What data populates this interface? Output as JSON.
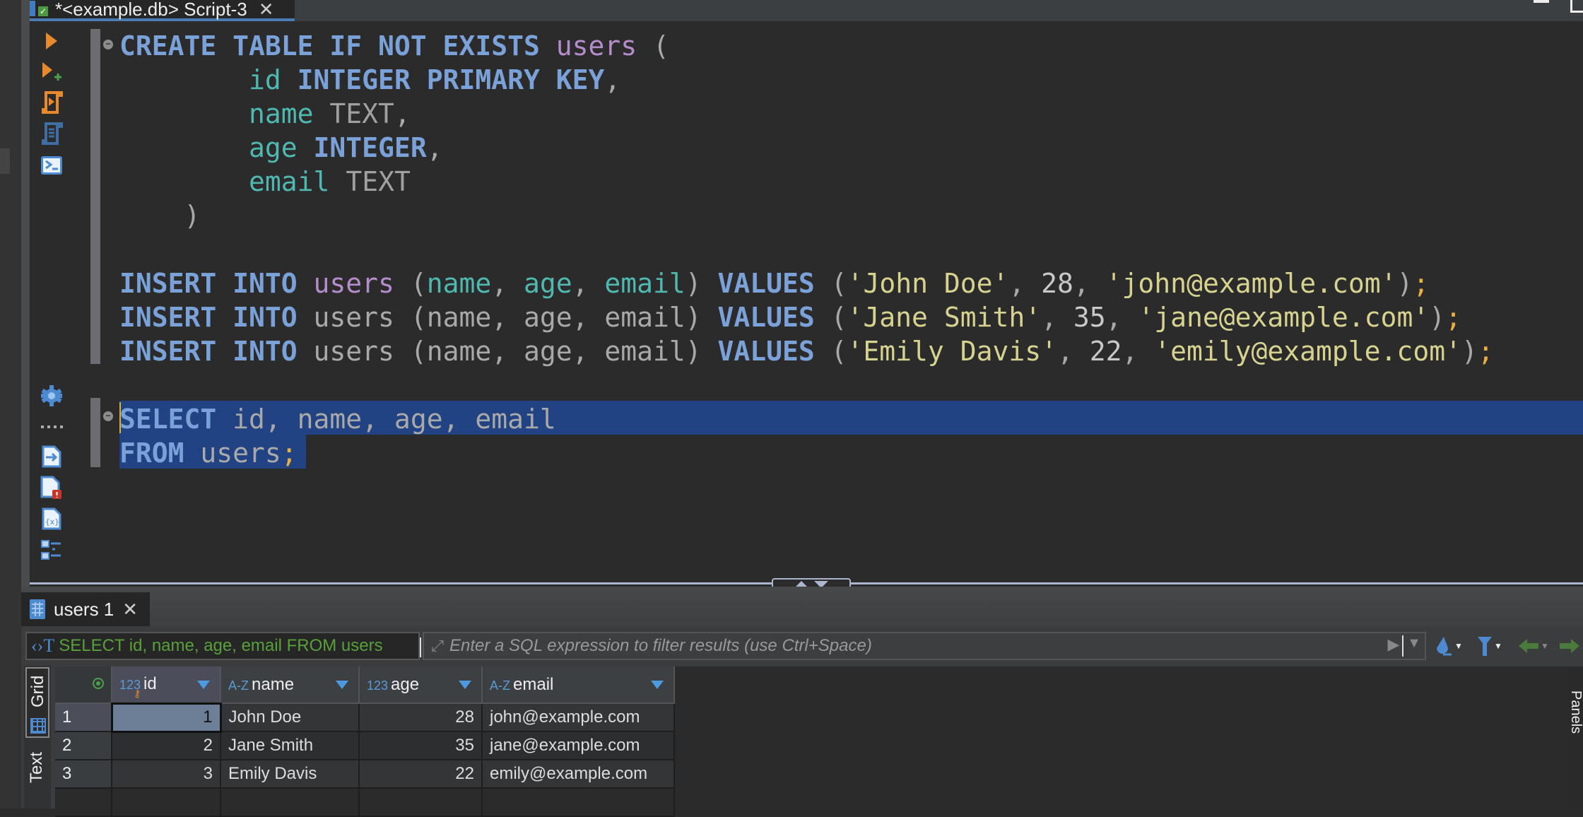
{
  "window": {
    "editor_tab": {
      "title": "*<example.db> Script-3",
      "icon": "sqlite-db-connected-icon",
      "close": "✕"
    }
  },
  "editor_toolbar": [
    {
      "name": "execute-statement",
      "icon": "play-icon"
    },
    {
      "name": "execute-in-new-tab",
      "icon": "play-plus-icon"
    },
    {
      "name": "execute-script",
      "icon": "script-run-icon"
    },
    {
      "name": "execute-script-new-tab",
      "icon": "script-list-icon"
    },
    {
      "name": "open-console",
      "icon": "terminal-icon"
    },
    {
      "name": "settings",
      "icon": "gear-icon"
    },
    {
      "name": "more",
      "icon": "dots-icon"
    },
    {
      "name": "export-from-query",
      "icon": "file-export-icon"
    },
    {
      "name": "show-problems",
      "icon": "file-error-icon"
    },
    {
      "name": "variables",
      "icon": "file-variables-icon"
    },
    {
      "name": "outline",
      "icon": "outline-icon"
    }
  ],
  "code": {
    "lines": [
      [
        {
          "t": "CREATE TABLE IF NOT EXISTS ",
          "c": "kw"
        },
        {
          "t": "users",
          "c": "tbl"
        },
        {
          "t": " (",
          "c": "plain"
        }
      ],
      [
        {
          "t": "        ",
          "c": "plain"
        },
        {
          "t": "id ",
          "c": "col"
        },
        {
          "t": "INTEGER PRIMARY KEY",
          "c": "kw"
        },
        {
          "t": ",",
          "c": "plain"
        }
      ],
      [
        {
          "t": "        ",
          "c": "plain"
        },
        {
          "t": "name ",
          "c": "col"
        },
        {
          "t": "TEXT",
          "c": "type"
        },
        {
          "t": ",",
          "c": "plain"
        }
      ],
      [
        {
          "t": "        ",
          "c": "plain"
        },
        {
          "t": "age ",
          "c": "col"
        },
        {
          "t": "INTEGER",
          "c": "kw"
        },
        {
          "t": ",",
          "c": "plain"
        }
      ],
      [
        {
          "t": "        ",
          "c": "plain"
        },
        {
          "t": "email ",
          "c": "col"
        },
        {
          "t": "TEXT",
          "c": "type"
        }
      ],
      [
        {
          "t": "    )",
          "c": "plain"
        }
      ],
      [],
      [
        {
          "t": "INSERT INTO ",
          "c": "kw"
        },
        {
          "t": "users",
          "c": "tbl"
        },
        {
          "t": " (",
          "c": "plain"
        },
        {
          "t": "name",
          "c": "col"
        },
        {
          "t": ", ",
          "c": "plain"
        },
        {
          "t": "age",
          "c": "col"
        },
        {
          "t": ", ",
          "c": "plain"
        },
        {
          "t": "email",
          "c": "col"
        },
        {
          "t": ") ",
          "c": "plain"
        },
        {
          "t": "VALUES",
          "c": "kw"
        },
        {
          "t": " (",
          "c": "plain"
        },
        {
          "t": "'John Doe'",
          "c": "str"
        },
        {
          "t": ", ",
          "c": "plain"
        },
        {
          "t": "28",
          "c": "num"
        },
        {
          "t": ", ",
          "c": "plain"
        },
        {
          "t": "'john@example.com'",
          "c": "str"
        },
        {
          "t": ")",
          "c": "plain"
        },
        {
          "t": ";",
          "c": "semi"
        }
      ],
      [
        {
          "t": "INSERT INTO ",
          "c": "kw"
        },
        {
          "t": "users (name, age, email) ",
          "c": "plain"
        },
        {
          "t": "VALUES",
          "c": "kw"
        },
        {
          "t": " (",
          "c": "plain"
        },
        {
          "t": "'Jane Smith'",
          "c": "str"
        },
        {
          "t": ", ",
          "c": "plain"
        },
        {
          "t": "35",
          "c": "num"
        },
        {
          "t": ", ",
          "c": "plain"
        },
        {
          "t": "'jane@example.com'",
          "c": "str"
        },
        {
          "t": ")",
          "c": "plain"
        },
        {
          "t": ";",
          "c": "semi"
        }
      ],
      [
        {
          "t": "INSERT INTO ",
          "c": "kw"
        },
        {
          "t": "users (name, age, email) ",
          "c": "plain"
        },
        {
          "t": "VALUES",
          "c": "kw"
        },
        {
          "t": " (",
          "c": "plain"
        },
        {
          "t": "'Emily Davis'",
          "c": "str"
        },
        {
          "t": ", ",
          "c": "plain"
        },
        {
          "t": "22",
          "c": "num"
        },
        {
          "t": ", ",
          "c": "plain"
        },
        {
          "t": "'emily@example.com'",
          "c": "str"
        },
        {
          "t": ")",
          "c": "plain"
        },
        {
          "t": ";",
          "c": "semi"
        }
      ],
      [],
      [
        {
          "t": "SELECT ",
          "c": "kw"
        },
        {
          "t": "id, name, age, email",
          "c": "plain"
        }
      ],
      [
        {
          "t": "FROM ",
          "c": "kw"
        },
        {
          "t": "users",
          "c": "plain"
        },
        {
          "t": ";",
          "c": "semi"
        }
      ]
    ],
    "selected_lines": [
      11,
      12
    ]
  },
  "results": {
    "tab_label": "users 1",
    "tab_close": "✕",
    "query_text": "SELECT id, name, age, email FROM users",
    "filter_placeholder": "Enter a SQL expression to filter results (use Ctrl+Space)",
    "side_tabs": {
      "grid": "Grid",
      "text": "Text"
    },
    "panels_label": "Panels",
    "columns": [
      {
        "name": "id",
        "type_label": "123",
        "primary_key": true
      },
      {
        "name": "name",
        "type_label": "A-Z"
      },
      {
        "name": "age",
        "type_label": "123"
      },
      {
        "name": "email",
        "type_label": "A-Z"
      }
    ],
    "rows": [
      {
        "num": "1",
        "id": "1",
        "name": "John Doe",
        "age": "28",
        "email": "john@example.com"
      },
      {
        "num": "2",
        "id": "2",
        "name": "Jane Smith",
        "age": "35",
        "email": "jane@example.com"
      },
      {
        "num": "3",
        "id": "3",
        "name": "Emily Davis",
        "age": "22",
        "email": "emily@example.com"
      }
    ]
  },
  "colors": {
    "keyword": "#7aa2d8",
    "table": "#b58ccc",
    "column": "#4fb8b0",
    "string": "#d6d28f",
    "selection": "#214283",
    "query_text": "#58a03a",
    "accent": "#4d8ad0"
  }
}
